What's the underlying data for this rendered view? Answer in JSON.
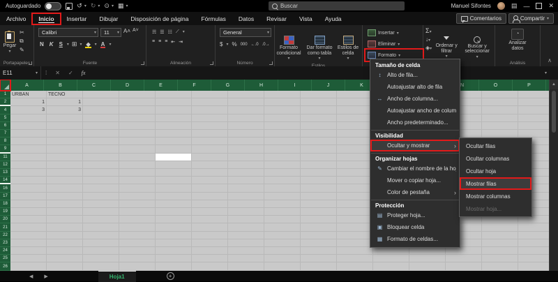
{
  "titlebar": {
    "autosave": "Autoguardado",
    "search": "Buscar",
    "user": "Manuel Sifontes"
  },
  "tabrow": {
    "tabs": [
      "Archivo",
      "Inicio",
      "Insertar",
      "Dibujar",
      "Disposición de página",
      "Fórmulas",
      "Datos",
      "Revisar",
      "Vista",
      "Ayuda"
    ],
    "active_tab": "Inicio",
    "comments": "Comentarios",
    "share": "Compartir"
  },
  "ribbon": {
    "paste": "Pegar",
    "font_name": "Calibri",
    "font_size": "11",
    "bold": "N",
    "italic": "K",
    "underline": "S",
    "number_format": "General",
    "conditional": "Formato condicional",
    "format_table": "Dar formato como tabla",
    "cell_styles": "Estilos de celda",
    "insert": "Insertar",
    "delete": "Eliminar",
    "format": "Formato",
    "sort_filter": "Ordenar y filtrar",
    "find_select": "Buscar y seleccionar",
    "analyze": "Analizar datos",
    "groups": [
      "Portapapeles",
      "Fuente",
      "Alineación",
      "Número",
      "Estilos",
      "Análisis"
    ]
  },
  "formula_bar": {
    "name_box": "E11",
    "fx": "fx"
  },
  "grid": {
    "columns": [
      "A",
      "B",
      "C",
      "D",
      "E",
      "F",
      "G",
      "H",
      "I",
      "J",
      "K",
      "L",
      "M",
      "N",
      "O",
      "P"
    ],
    "rows": [
      1,
      2,
      4,
      5,
      6,
      7,
      8,
      9,
      11,
      12,
      13,
      14,
      16,
      17,
      18,
      19,
      20,
      21,
      22,
      23,
      24,
      25,
      26
    ],
    "hidden_after": [
      2,
      9,
      14
    ],
    "cells": {
      "1": {
        "A": "URBAN",
        "B": "TECNO"
      },
      "2": {
        "A": "1",
        "B": "1"
      },
      "4": {
        "A": "3",
        "B": "3"
      }
    },
    "selected": {
      "col": "E",
      "row": 11
    }
  },
  "format_menu": {
    "sections": [
      {
        "header": "Tamaño de celda",
        "items": [
          {
            "label": "Alto de fila...",
            "icon": "row-height-icon"
          },
          {
            "label": "Autoajustar alto de fila"
          },
          {
            "label": "Ancho de columna...",
            "icon": "column-width-icon"
          },
          {
            "label": "Autoajustar ancho de columna"
          },
          {
            "label": "Ancho predeterminado..."
          }
        ]
      },
      {
        "header": "Visibilidad",
        "items": [
          {
            "label": "Ocultar y mostrar",
            "submenu": true,
            "highlighted": true
          }
        ]
      },
      {
        "header": "Organizar hojas",
        "items": [
          {
            "label": "Cambiar el nombre de la hoja",
            "icon": "rename-sheet-icon"
          },
          {
            "label": "Mover o copiar hoja..."
          },
          {
            "label": "Color de pestaña",
            "submenu": true
          }
        ]
      },
      {
        "header": "Protección",
        "items": [
          {
            "label": "Proteger hoja...",
            "icon": "protect-sheet-icon"
          },
          {
            "label": "Bloquear celda",
            "icon": "lock-icon"
          },
          {
            "label": "Formato de celdas...",
            "icon": "format-cells-icon"
          }
        ]
      }
    ]
  },
  "hide_show_submenu": {
    "items": [
      {
        "label": "Ocultar filas"
      },
      {
        "label": "Ocultar columnas"
      },
      {
        "label": "Ocultar hoja"
      },
      {
        "label": "Mostrar filas",
        "highlighted": true
      },
      {
        "label": "Mostrar columnas"
      },
      {
        "label": "Mostrar hoja...",
        "disabled": true
      }
    ]
  },
  "sheet_bar": {
    "tab": "Hoja1"
  },
  "colors": {
    "header_green": "#1e5c38",
    "annotation_red": "#e21a1a",
    "grid_bg": "#c9c9c9",
    "sheet_tab_green": "#34b46e"
  }
}
